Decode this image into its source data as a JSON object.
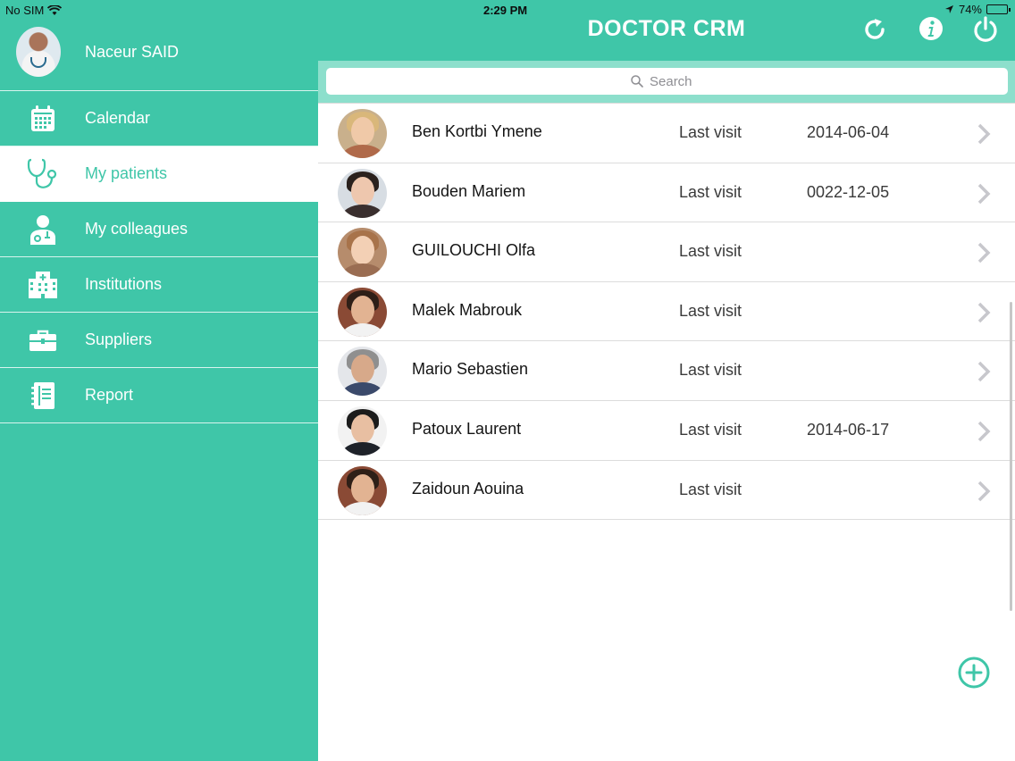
{
  "status": {
    "carrier": "No SIM",
    "time": "2:29 PM",
    "battery": "74%",
    "battery_level": 0.74
  },
  "header": {
    "title": "DOCTOR CRM",
    "buttons": [
      "refresh-icon",
      "info-icon",
      "power-icon"
    ]
  },
  "profile": {
    "name": "Naceur SAID"
  },
  "sidebar": {
    "items": [
      {
        "label": "Calendar",
        "icon": "calendar-icon",
        "active": false
      },
      {
        "label": "My patients",
        "icon": "stethoscope-icon",
        "active": true
      },
      {
        "label": "My colleagues",
        "icon": "doctor-icon",
        "active": false
      },
      {
        "label": "Institutions",
        "icon": "hospital-building-icon",
        "active": false
      },
      {
        "label": "Suppliers",
        "icon": "briefcase-icon",
        "active": false
      },
      {
        "label": "Report",
        "icon": "notebook-icon",
        "active": false
      }
    ]
  },
  "search": {
    "placeholder": "Search"
  },
  "patients": [
    {
      "name": "Ben Kortbi Ymene",
      "label": "Last visit",
      "date": "2014-06-04"
    },
    {
      "name": "Bouden Mariem",
      "label": "Last visit",
      "date": "0022-12-05"
    },
    {
      "name": "GUILOUCHI Olfa",
      "label": "Last visit",
      "date": ""
    },
    {
      "name": "Malek Mabrouk",
      "label": "Last visit",
      "date": ""
    },
    {
      "name": "Mario Sebastien",
      "label": "Last visit",
      "date": ""
    },
    {
      "name": "Patoux Laurent",
      "label": "Last visit",
      "date": "2014-06-17"
    },
    {
      "name": "Zaidoun Aouina",
      "label": "Last visit",
      "date": ""
    }
  ],
  "colors": {
    "accent": "#3fc6a8",
    "search_bg": "#8ddfcc",
    "divider": "#dcdcdc"
  }
}
